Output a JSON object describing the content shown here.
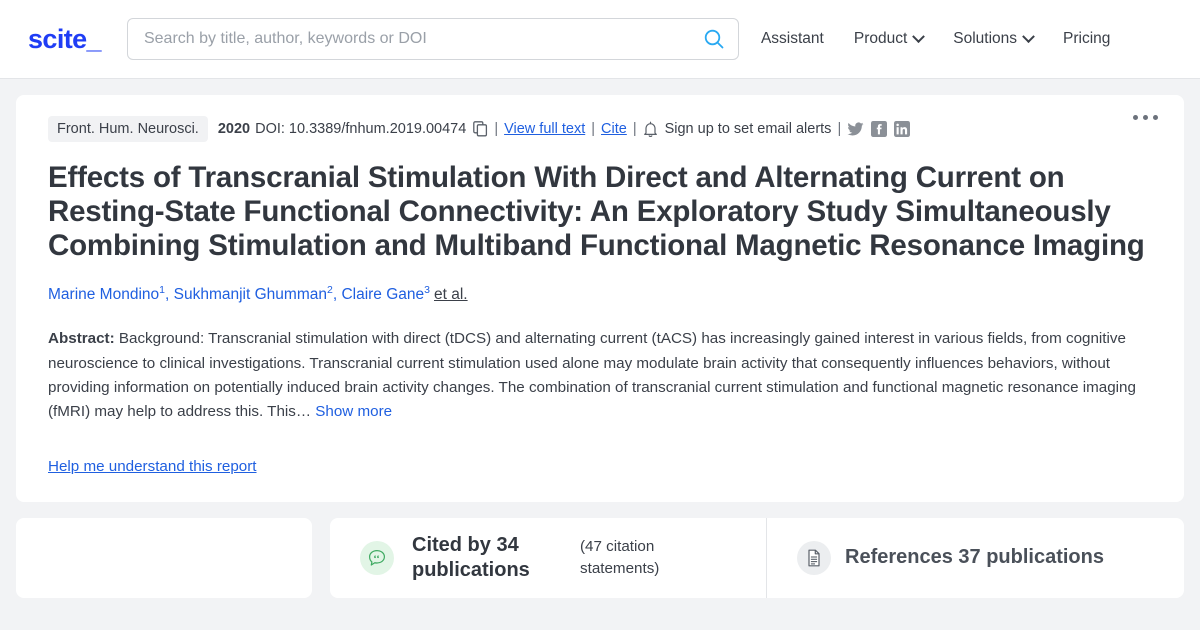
{
  "header": {
    "logo": "scite_",
    "search": {
      "placeholder": "Search by title, author, keywords or DOI",
      "value": "",
      "icon": "search-icon"
    },
    "nav": [
      {
        "label": "Assistant",
        "has_caret": false
      },
      {
        "label": "Product",
        "has_caret": true
      },
      {
        "label": "Solutions",
        "has_caret": true
      },
      {
        "label": "Pricing",
        "has_caret": false
      }
    ]
  },
  "paper": {
    "journal": "Front. Hum. Neurosci.",
    "year": "2020",
    "doi": "DOI: 10.3389/fnhum.2019.00474",
    "copy_icon": "copy-icon",
    "sep": "|",
    "view_full_text": "View full text",
    "cite": "Cite",
    "bell_icon": "bell-icon",
    "email_alerts": "Sign up to set email alerts",
    "social": [
      "twitter-icon",
      "facebook-icon",
      "linkedin-icon"
    ],
    "title": "Effects of Transcranial Stimulation With Direct and Alternating Current on Resting-State Functional Connectivity: An Exploratory Study Simultaneously Combining Stimulation and Multiband Functional Magnetic Resonance Imaging",
    "authors": [
      {
        "name": "Marine Mondino",
        "sup": "1",
        "comma": ","
      },
      {
        "name": "Sukhmanjit Ghumman",
        "sup": "2",
        "comma": ","
      },
      {
        "name": "Claire Gane",
        "sup": "3",
        "comma": ""
      }
    ],
    "et_al": "et al.",
    "abstract_label": "Abstract:",
    "abstract_text": " Background: Transcranial stimulation with direct (tDCS) and alternating current (tACS) has increasingly gained interest in various fields, from cognitive neuroscience to clinical investigations. Transcranial current stimulation used alone may modulate brain activity that consequently influences behaviors, without providing information on potentially induced brain activity changes. The combination of transcranial current stimulation and functional magnetic resonance imaging (fMRI) may help to address this. This… ",
    "show_more": "Show more",
    "help_link": "Help me understand this report"
  },
  "stats": {
    "cited_by": "Cited by 34 publications",
    "citation_statements": "(47 citation statements)",
    "cited_icon": "citation-bubble-icon",
    "references": "References 37 publications",
    "references_icon": "document-icon"
  },
  "colors": {
    "brand_blue": "#1f3df5",
    "link_blue": "#1f5fe0",
    "search_icon_blue": "#29a9f2",
    "green_badge": "#e2f5e6",
    "green_icon": "#3faa62",
    "page_bg": "#f2f3f5",
    "text": "#3b4049"
  }
}
